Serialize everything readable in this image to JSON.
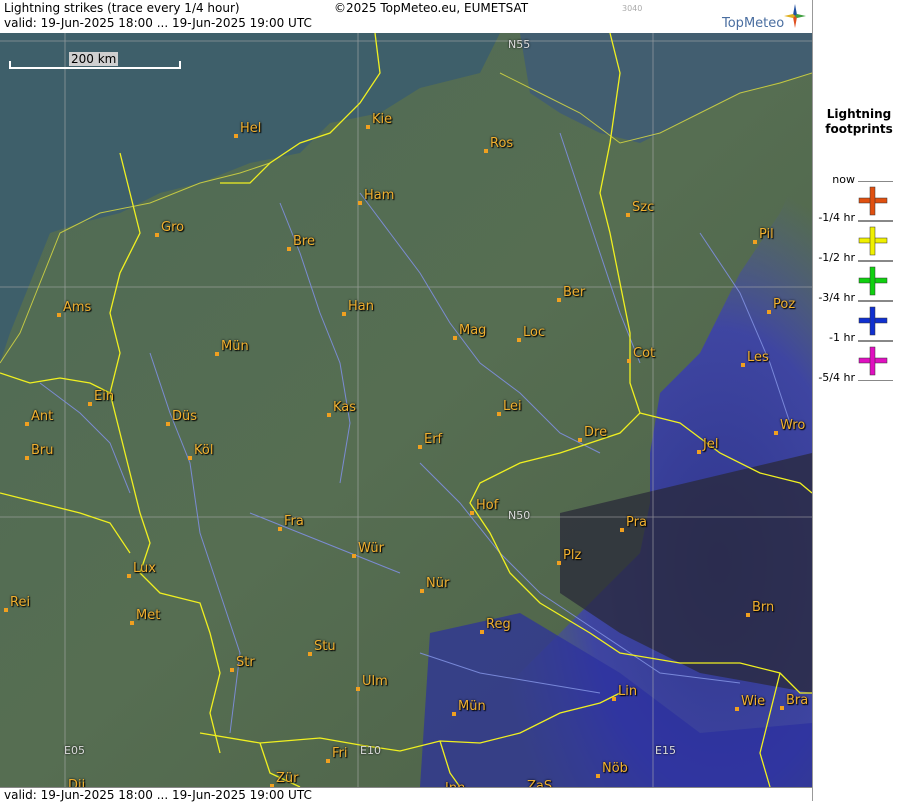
{
  "header": {
    "title": "Lightning strikes (trace every 1/4 hour)",
    "copyright": "©2025 TopMeteo.eu, EUMETSAT",
    "code": "3040",
    "valid": "valid:  19-Jun-2025 18:00 ... 19-Jun-2025 19:00 UTC",
    "logo_text": "TopMeteo"
  },
  "footer": {
    "valid": "valid:  19-Jun-2025 18:00 ... 19-Jun-2025 19:00 UTC"
  },
  "scale": {
    "label": "200 km"
  },
  "legend": {
    "title_line1": "Lightning",
    "title_line2": "footprints",
    "entries": [
      {
        "top": "now",
        "bottom": "-1/4 hr",
        "color": "#e05010"
      },
      {
        "top": "",
        "bottom": "-1/2 hr",
        "color": "#f0f000"
      },
      {
        "top": "",
        "bottom": "-3/4 hr",
        "color": "#10d010"
      },
      {
        "top": "",
        "bottom": "-1 hr",
        "color": "#1030d0"
      },
      {
        "top": "",
        "bottom": "-5/4 hr",
        "color": "#e010c0"
      }
    ]
  },
  "grid_labels": {
    "n55": "N55",
    "n50": "N50",
    "e05": "E05",
    "e10": "E10",
    "e15": "E15"
  },
  "cities": [
    {
      "name": "Kie"
    },
    {
      "name": "Hel"
    },
    {
      "name": "Ros"
    },
    {
      "name": "Ham"
    },
    {
      "name": "Szc"
    },
    {
      "name": "Gro"
    },
    {
      "name": "Bre"
    },
    {
      "name": "Pil"
    },
    {
      "name": "Ber"
    },
    {
      "name": "Ams"
    },
    {
      "name": "Han"
    },
    {
      "name": "Poz"
    },
    {
      "name": "Mag"
    },
    {
      "name": "Loc"
    },
    {
      "name": "Mün"
    },
    {
      "name": "Cot"
    },
    {
      "name": "Les"
    },
    {
      "name": "Ein"
    },
    {
      "name": "Kas"
    },
    {
      "name": "Lei"
    },
    {
      "name": "Ant"
    },
    {
      "name": "Düs"
    },
    {
      "name": "Wro"
    },
    {
      "name": "Erf"
    },
    {
      "name": "Dre"
    },
    {
      "name": "Bru"
    },
    {
      "name": "Köl"
    },
    {
      "name": "Jel"
    },
    {
      "name": "Hof"
    },
    {
      "name": "Fra"
    },
    {
      "name": "Pra"
    },
    {
      "name": "Wür"
    },
    {
      "name": "Plz"
    },
    {
      "name": "Lux"
    },
    {
      "name": "Nür"
    },
    {
      "name": "Rei"
    },
    {
      "name": "Met"
    },
    {
      "name": "Brn"
    },
    {
      "name": "Reg"
    },
    {
      "name": "Stu"
    },
    {
      "name": "Str"
    },
    {
      "name": "Ulm"
    },
    {
      "name": "Lin"
    },
    {
      "name": "Mün"
    },
    {
      "name": "Wie"
    },
    {
      "name": "Bra"
    },
    {
      "name": "Fri"
    },
    {
      "name": "Nöb"
    },
    {
      "name": "Dij"
    },
    {
      "name": "Zür"
    },
    {
      "name": "Inn"
    },
    {
      "name": "ZaS"
    }
  ]
}
